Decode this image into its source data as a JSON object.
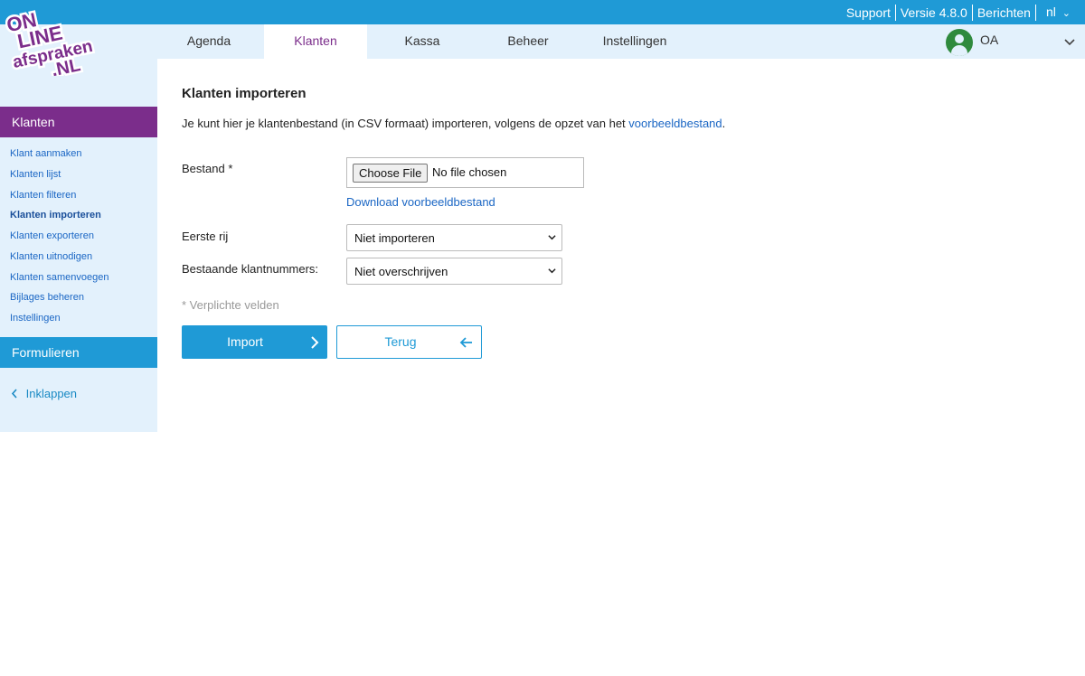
{
  "topbar": {
    "support": "Support",
    "version": "Versie 4.8.0",
    "messages": "Berichten",
    "language": "nl"
  },
  "logo": {
    "line1": "ON",
    "line2": "LINE",
    "line3": "afspraken",
    "line4": ".NL"
  },
  "nav": {
    "items": [
      "Agenda",
      "Klanten",
      "Kassa",
      "Beheer",
      "Instellingen"
    ],
    "active": "Klanten"
  },
  "user": {
    "initials": "OA"
  },
  "sidebar": {
    "section_klanten": "Klanten",
    "links": [
      "Klant aanmaken",
      "Klanten lijst",
      "Klanten filteren",
      "Klanten importeren",
      "Klanten exporteren",
      "Klanten uitnodigen",
      "Klanten samenvoegen",
      "Bijlages beheren",
      "Instellingen"
    ],
    "current": "Klanten importeren",
    "section_formulieren": "Formulieren",
    "collapse": "Inklappen"
  },
  "main": {
    "title": "Klanten importeren",
    "intro_text": "Je kunt hier je klantenbestand (in CSV formaat) importeren, volgens de opzet van het ",
    "intro_link": "voorbeeldbestand",
    "intro_end": ".",
    "file_label": "Bestand *",
    "file_button": "Choose File",
    "file_status": "No file chosen",
    "download_link": "Download voorbeeldbestand",
    "first_row_label": "Eerste rij",
    "first_row_value": "Niet importeren",
    "existing_label": "Bestaande klantnummers:",
    "existing_value": "Niet overschrijven",
    "required_note": "* Verplichte velden",
    "import_button": "Import",
    "back_button": "Terug"
  },
  "colors": {
    "primary_blue": "#1f9ad6",
    "purple": "#7b2d8b",
    "light_blue_bg": "#e3f1fc",
    "link_blue": "#1a66c4"
  }
}
